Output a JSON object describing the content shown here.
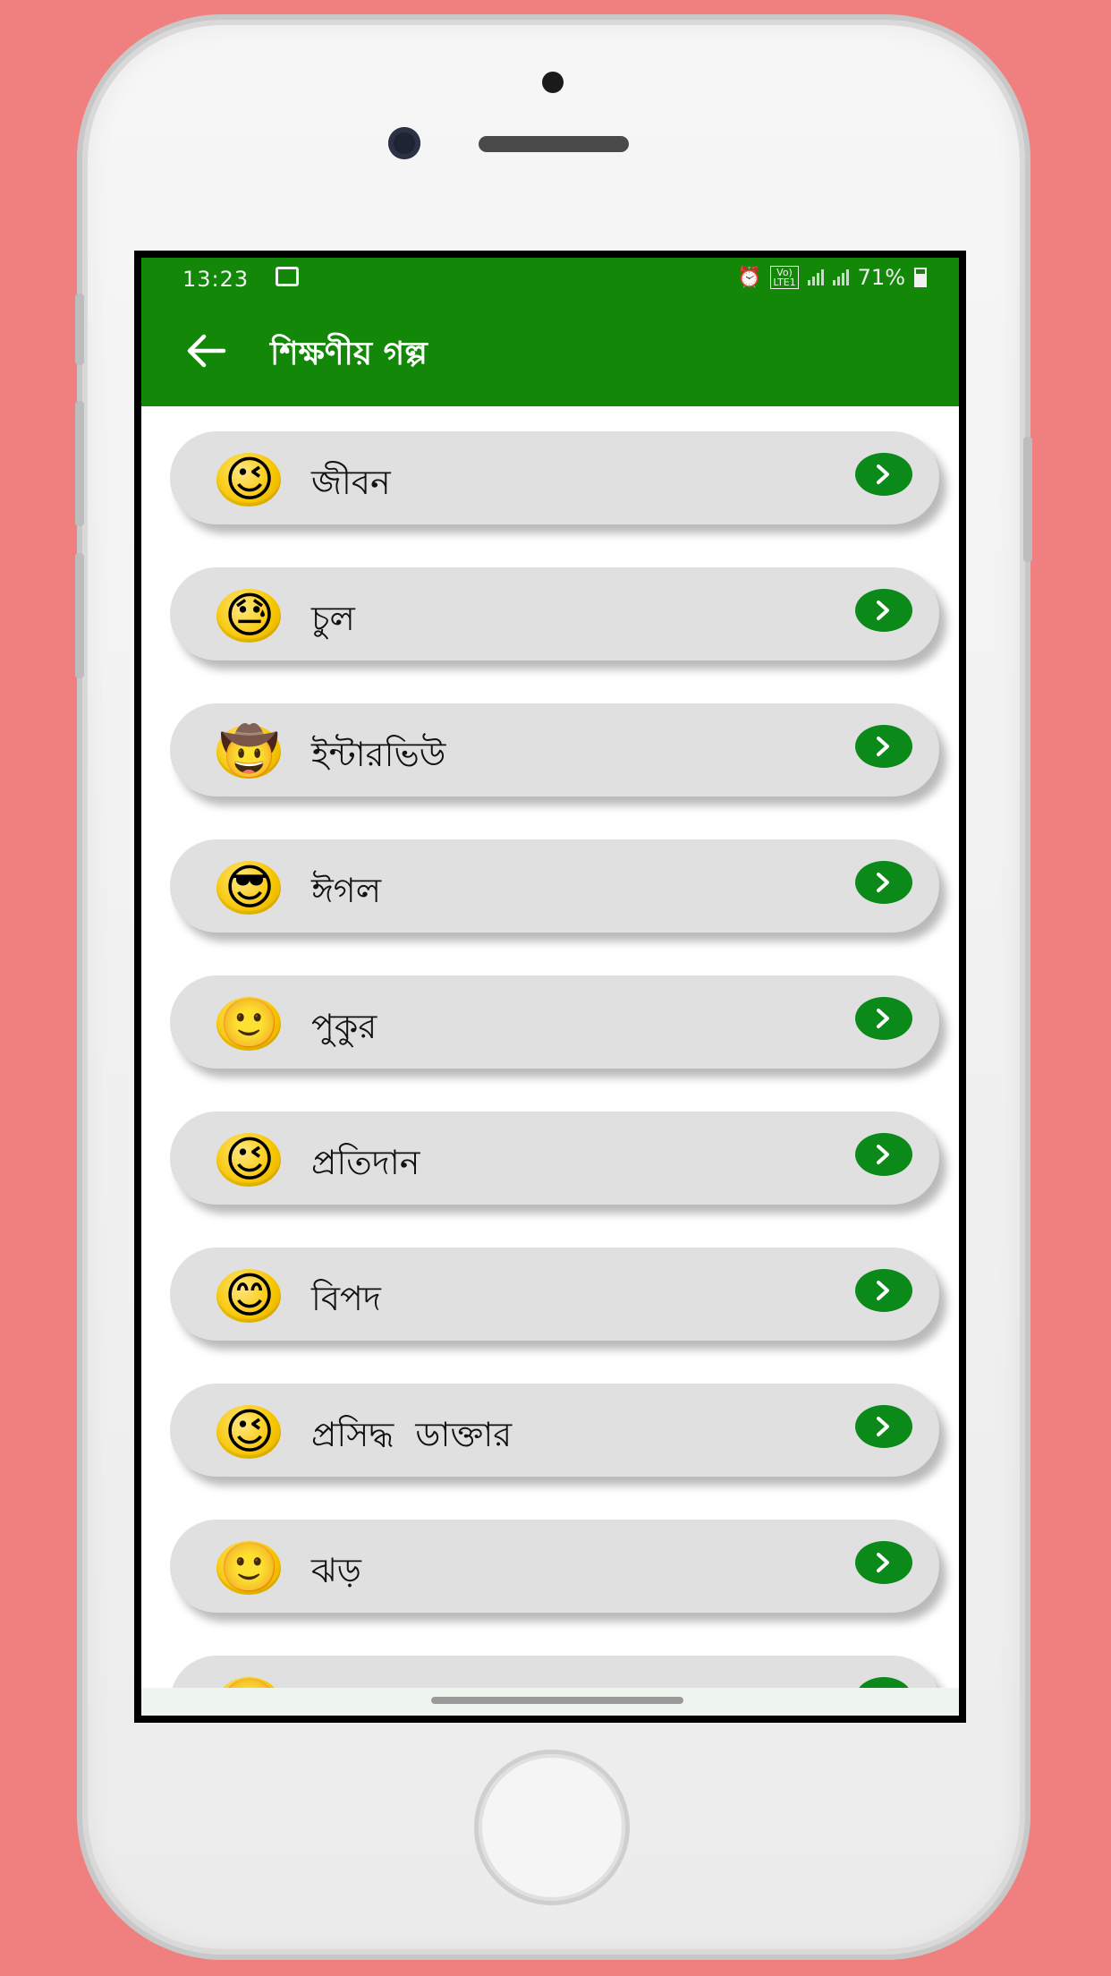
{
  "status_bar": {
    "time": "13:23",
    "network_label": "Vo)) LTE1",
    "battery": "71%"
  },
  "app_bar": {
    "title": "শিক্ষণীয় গল্প",
    "back_icon": "arrow-left-icon"
  },
  "colors": {
    "background": "#f08080",
    "app_bar": "#138808",
    "card": "#e0e0e0",
    "button": "#0b8a1a"
  },
  "stories": [
    {
      "label": "জীবন",
      "emoji": "😉"
    },
    {
      "label": "চুল",
      "emoji": "😓"
    },
    {
      "label": "ইন্টারভিউ",
      "emoji": "🤠"
    },
    {
      "label": "ঈগল",
      "emoji": "😎"
    },
    {
      "label": "পুকুর",
      "emoji": "🙂"
    },
    {
      "label": "প্রতিদান",
      "emoji": "😉"
    },
    {
      "label": "বিপদ",
      "emoji": "😊"
    },
    {
      "label": "প্রসিদ্ধ  ডাক্তার",
      "emoji": "😉"
    },
    {
      "label": "ঝড়",
      "emoji": "🙂"
    },
    {
      "label": "",
      "emoji": "🙂"
    }
  ]
}
